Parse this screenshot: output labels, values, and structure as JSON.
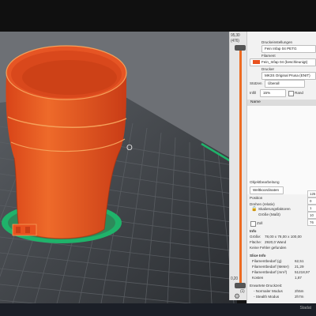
{
  "viewport": {
    "bed_color": "#2f3236",
    "grid_color": "#5d6166",
    "model_color": "#e8521f",
    "model_highlight": "#f07a3a",
    "seam_color": "#f5a05a",
    "brim_color": "#1fb36a",
    "marker_text": "O"
  },
  "slider": {
    "top_labels": [
      "95,30",
      "(476)"
    ],
    "bottom_labels": [
      "0,20",
      "(1)"
    ],
    "accent": "#ed6b21",
    "settings_icon": "gear-icon"
  },
  "panel": {
    "print_settings_label": "Druckeinstellungen",
    "print_profile": "Fein Infap 04 PETG",
    "filament_label": "Filament",
    "filament_profile": "Fein_Infap 04 (beschleunigt)",
    "filament_color": "#e8521f",
    "printer_label": "Drucker",
    "printer_profile": "MK3S Original Prusa (ENIT)",
    "supports_label": "Stützen",
    "supports_value": "Überall",
    "infill_label": "Infill",
    "infill_value": "15%",
    "brim_label": "Rand",
    "list_header": "Name",
    "object_section": "Objektbearbeitung",
    "coord_select": "Weltkoordinaten",
    "position_label": "Position",
    "rotation_label": "Drehen (relativ)",
    "scale_factors_label": "Skalierungsfaktoren",
    "size_label": "Größe (Maßt)",
    "ruler_label": "Zoll",
    "right_values": [
      "125",
      "0",
      "1",
      "10",
      "76"
    ],
    "info_header": "Info",
    "size_info_label": "Größe:",
    "size_info_value": "78,00 x 78,00 x 100,00",
    "area_label": "Fläche:",
    "area_value": "2920,0 Wand",
    "errors_value": "Keine Fehler gefunden",
    "slice_header": "Slice Info",
    "slice_rows": [
      {
        "label": "Filamentbedarf (g)",
        "value": "62,51"
      },
      {
        "label": "Filamentbedarf (Meter)",
        "value": "21,29"
      },
      {
        "label": "Filamentbedarf (mm³)",
        "value": "51218,97"
      },
      {
        "label": "Kosten",
        "value": "1,87"
      }
    ],
    "print_time_label": "Erwartete Druckzeit:",
    "print_time_rows": [
      {
        "label": "- Normaler Modus",
        "value": "2h5m"
      },
      {
        "label": "- Stealth Modus",
        "value": "2h7m"
      }
    ]
  },
  "taskbar": {
    "tray_text": "Stadat"
  }
}
